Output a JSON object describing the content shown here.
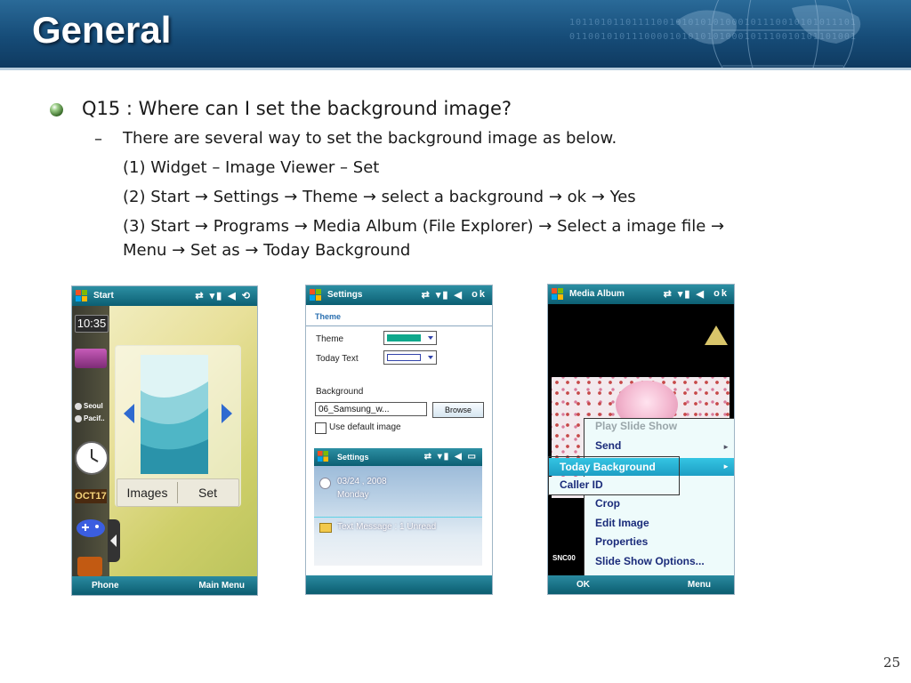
{
  "slide": {
    "title": "General",
    "page_number": "25",
    "header_binary_line1": "1011010110111100101010101000101110010101011101",
    "header_binary_line2": "0110010101110000101010101000101110010101101001"
  },
  "content": {
    "question": "Q15 : Where can I set the background image?",
    "dash": "–",
    "answer_intro": "There are several way to set the background image as below.",
    "option1": "(1) Widget – Image Viewer – Set",
    "option2": "(2) Start → Settings → Theme → select a background → ok → Yes",
    "option3_line1": "(3) Start → Programs → Media Album (File Explorer) → Select a image file →",
    "option3_line2": "Menu → Set as → Today Background"
  },
  "phone_start": {
    "title": "Start",
    "status_icons": "⇄ ▾▮ ◀ ⟲",
    "clock": "10:35",
    "city1": "Seoul",
    "city2": "Pacif..",
    "date": "OCT17",
    "images_button": "Images",
    "set_button": "Set",
    "softkey_left": "Phone",
    "softkey_right": "Main Menu"
  },
  "phone_settings": {
    "title": "Settings",
    "status_icons": "⇄ ▾▮ ◀",
    "ok": "ok",
    "subtitle": "Theme",
    "theme_label": "Theme",
    "today_text_label": "Today Text",
    "background_label": "Background",
    "background_value": "06_Samsung_w...",
    "browse_button": "Browse",
    "use_default_label": "Use default image",
    "theme_color": "#0fa88c",
    "preview": {
      "title": "Settings",
      "status_icons": "⇄ ▾▮ ◀ ▭",
      "date": "03/24 , 2008",
      "day": "Monday",
      "message": "Text Message : 1 Unread"
    }
  },
  "phone_media": {
    "title": "Media Album",
    "status_icons": "⇄ ▾▮ ◀",
    "ok": "ok",
    "partial_label": "SNC00",
    "menu": {
      "play_slide_show": "Play Slide Show",
      "send": "Send",
      "today_background": "Today Background",
      "caller_id": "Caller ID",
      "crop": "Crop",
      "edit_image": "Edit Image",
      "properties": "Properties",
      "slide_show_options": "Slide Show Options..."
    },
    "submenu_arrow": "►",
    "softkey_left": "OK",
    "softkey_right": "Menu"
  }
}
